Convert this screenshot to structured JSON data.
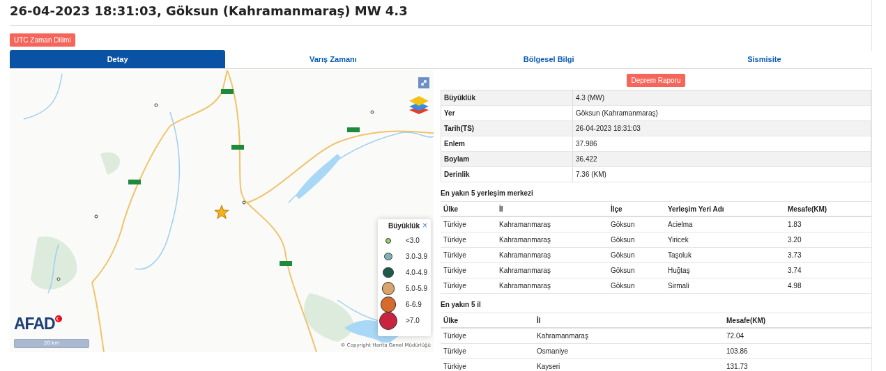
{
  "title": "26-04-2023 18:31:03, Göksun (Kahramanmaraş) MW 4.3",
  "utc_button": "UTC Zaman Dilimi",
  "tabs": [
    {
      "label": "Detay",
      "selected": true
    },
    {
      "label": "Varış Zamanı",
      "selected": false
    },
    {
      "label": "Bölgesel Bilgi",
      "selected": false
    },
    {
      "label": "Sismisite",
      "selected": false
    }
  ],
  "map": {
    "legend": {
      "title": "Büyüklük",
      "close": "×",
      "items": [
        {
          "label": "<3.0",
          "color": "#8fd36a"
        },
        {
          "label": "3.0-3.9",
          "color": "#7fb3b0"
        },
        {
          "label": "4.0-4.9",
          "color": "#1e5a4a"
        },
        {
          "label": "5.0-5.9",
          "color": "#d9a46a"
        },
        {
          "label": "6-6.9",
          "color": "#d66a2a"
        },
        {
          "label": ">7.0",
          "color": "#c8243f"
        }
      ]
    },
    "logo": "AFAD",
    "scale": "20 km",
    "copyright": "© Copyright Harita Genel Müdürlüğü"
  },
  "report_button": "Deprem Raporu",
  "details": [
    {
      "label": "Büyüklük",
      "value": "4.3 (MW)"
    },
    {
      "label": "Yer",
      "value": "Göksun (Kahramanmaraş)"
    },
    {
      "label": "Tarih(TS)",
      "value": "26-04-2023 18:31:03"
    },
    {
      "label": "Enlem",
      "value": "37.986"
    },
    {
      "label": "Boylam",
      "value": "36.422"
    },
    {
      "label": "Derinlik",
      "value": "7.36 (KM)"
    }
  ],
  "settlements": {
    "title": "En yakın 5 yerleşim merkezi",
    "columns": [
      "Ülke",
      "İl",
      "İlçe",
      "Yerleşim Yeri Adı",
      "Mesafe(KM)"
    ],
    "rows": [
      [
        "Türkiye",
        "Kahramanmaraş",
        "Göksun",
        "Acielma",
        "1.83"
      ],
      [
        "Türkiye",
        "Kahramanmaraş",
        "Göksun",
        "Yiricek",
        "3.20"
      ],
      [
        "Türkiye",
        "Kahramanmaraş",
        "Göksun",
        "Taşoluk",
        "3.73"
      ],
      [
        "Türkiye",
        "Kahramanmaraş",
        "Göksun",
        "Huğtaş",
        "3.74"
      ],
      [
        "Türkiye",
        "Kahramanmaraş",
        "Göksun",
        "Sirmali",
        "4.98"
      ]
    ]
  },
  "provinces": {
    "title": "En yakın 5 il",
    "columns": [
      "Ülke",
      "İl",
      "Mesafe(KM)"
    ],
    "rows": [
      [
        "Türkiye",
        "Kahramanmaraş",
        "72.04"
      ],
      [
        "Türkiye",
        "Osmaniye",
        "103.86"
      ],
      [
        "Türkiye",
        "Kayseri",
        "131.73"
      ]
    ]
  }
}
